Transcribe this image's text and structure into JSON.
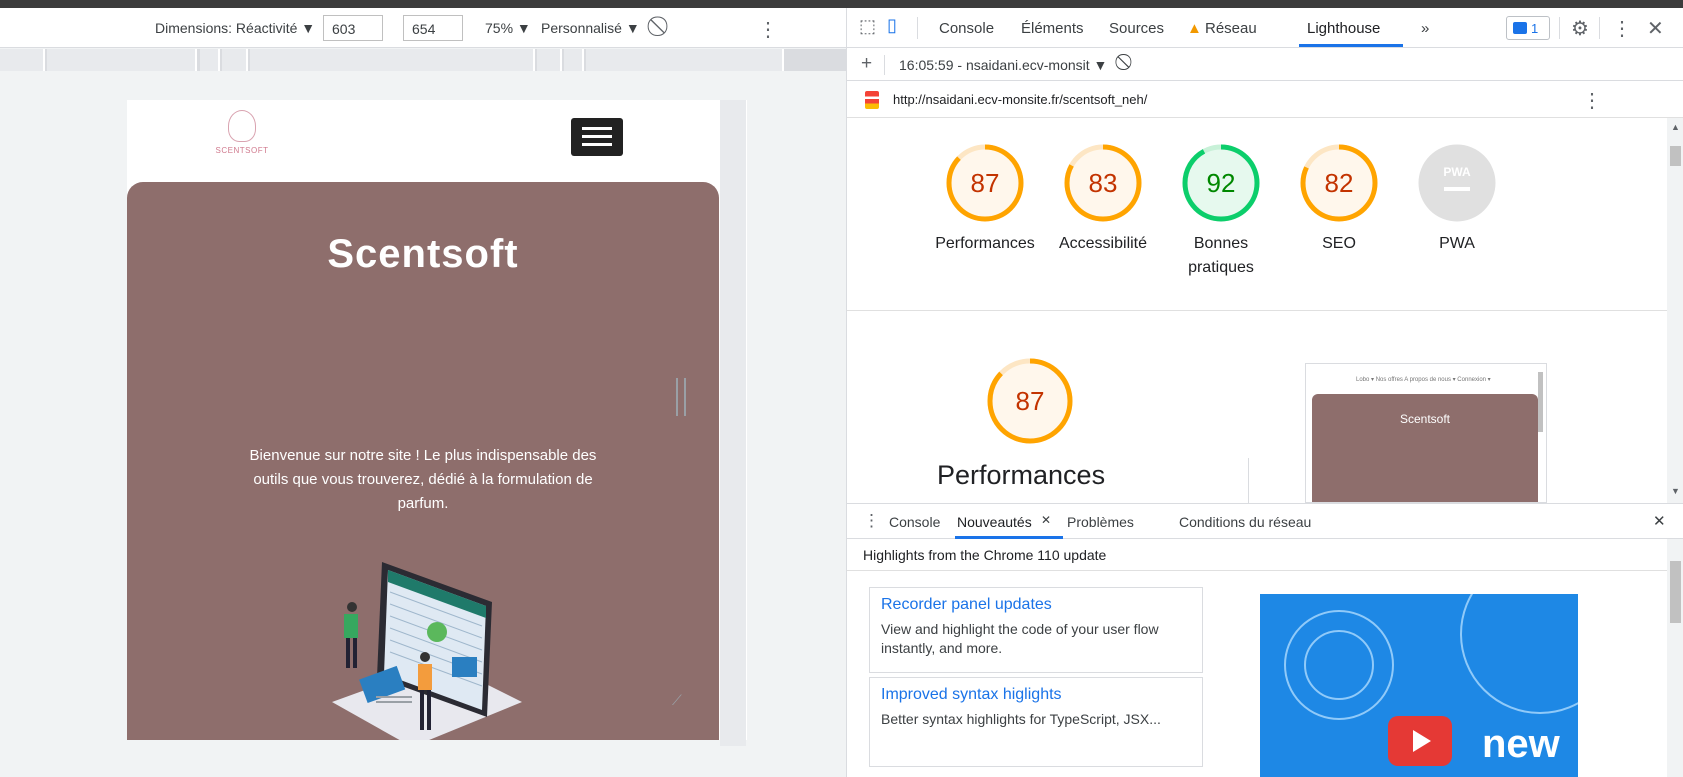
{
  "device_toolbar": {
    "dimensions_label": "Dimensions: Réactivité ▼",
    "width": "603",
    "times": "×",
    "height": "654",
    "zoom": "75% ▼",
    "throttle": "Personnalisé ▼"
  },
  "site": {
    "logo_text": "SCENTSOFT",
    "hero_title": "Scentsoft",
    "hero_text": "Bienvenue sur notre site ! Le plus indispensable des outils que vous trouverez, dédié à la formulation de parfum."
  },
  "devtools": {
    "tabs": [
      "Console",
      "Éléments",
      "Sources",
      "Réseau",
      "Lighthouse",
      "»"
    ],
    "active_tab": "Lighthouse",
    "issues_count": "1",
    "report_selector": "16:05:59 - nsaidani.ecv-monsit ▼",
    "url": "http://nsaidani.ecv-monsite.fr/scentsoft_neh/",
    "scores": [
      {
        "label": "Performances",
        "value": 87,
        "color": "#ffa400",
        "text_color": "#c33300"
      },
      {
        "label": "Accessibilité",
        "value": 83,
        "color": "#ffa400",
        "text_color": "#c33300"
      },
      {
        "label": "Bonnes pratiques",
        "value": 92,
        "color": "#0cce6b",
        "text_color": "#008800"
      },
      {
        "label": "SEO",
        "value": 82,
        "color": "#ffa400",
        "text_color": "#c33300"
      },
      {
        "label": "PWA",
        "value": null,
        "color": "#cccccc",
        "text_color": "#ffffff",
        "badge": "PWA"
      }
    ],
    "main_score": {
      "value": 87,
      "label": "Performances"
    },
    "thumbnail": {
      "nav": "Lobo ▾   Nos offres   A propos de nous ▾   Connexion ▾",
      "title": "Scentsoft"
    },
    "drawer": {
      "tabs": [
        "Console",
        "Nouveautés",
        "Problèmes",
        "Conditions du réseau"
      ],
      "active_tab": "Nouveautés",
      "highlights": "Highlights from the Chrome 110 update",
      "cards": [
        {
          "title": "Recorder panel updates",
          "desc": "View and highlight the code of your user flow instantly, and more."
        },
        {
          "title": "Improved syntax higlights",
          "desc": "Better syntax highlights for TypeScript, JSX..."
        }
      ],
      "video_word": "new"
    }
  }
}
